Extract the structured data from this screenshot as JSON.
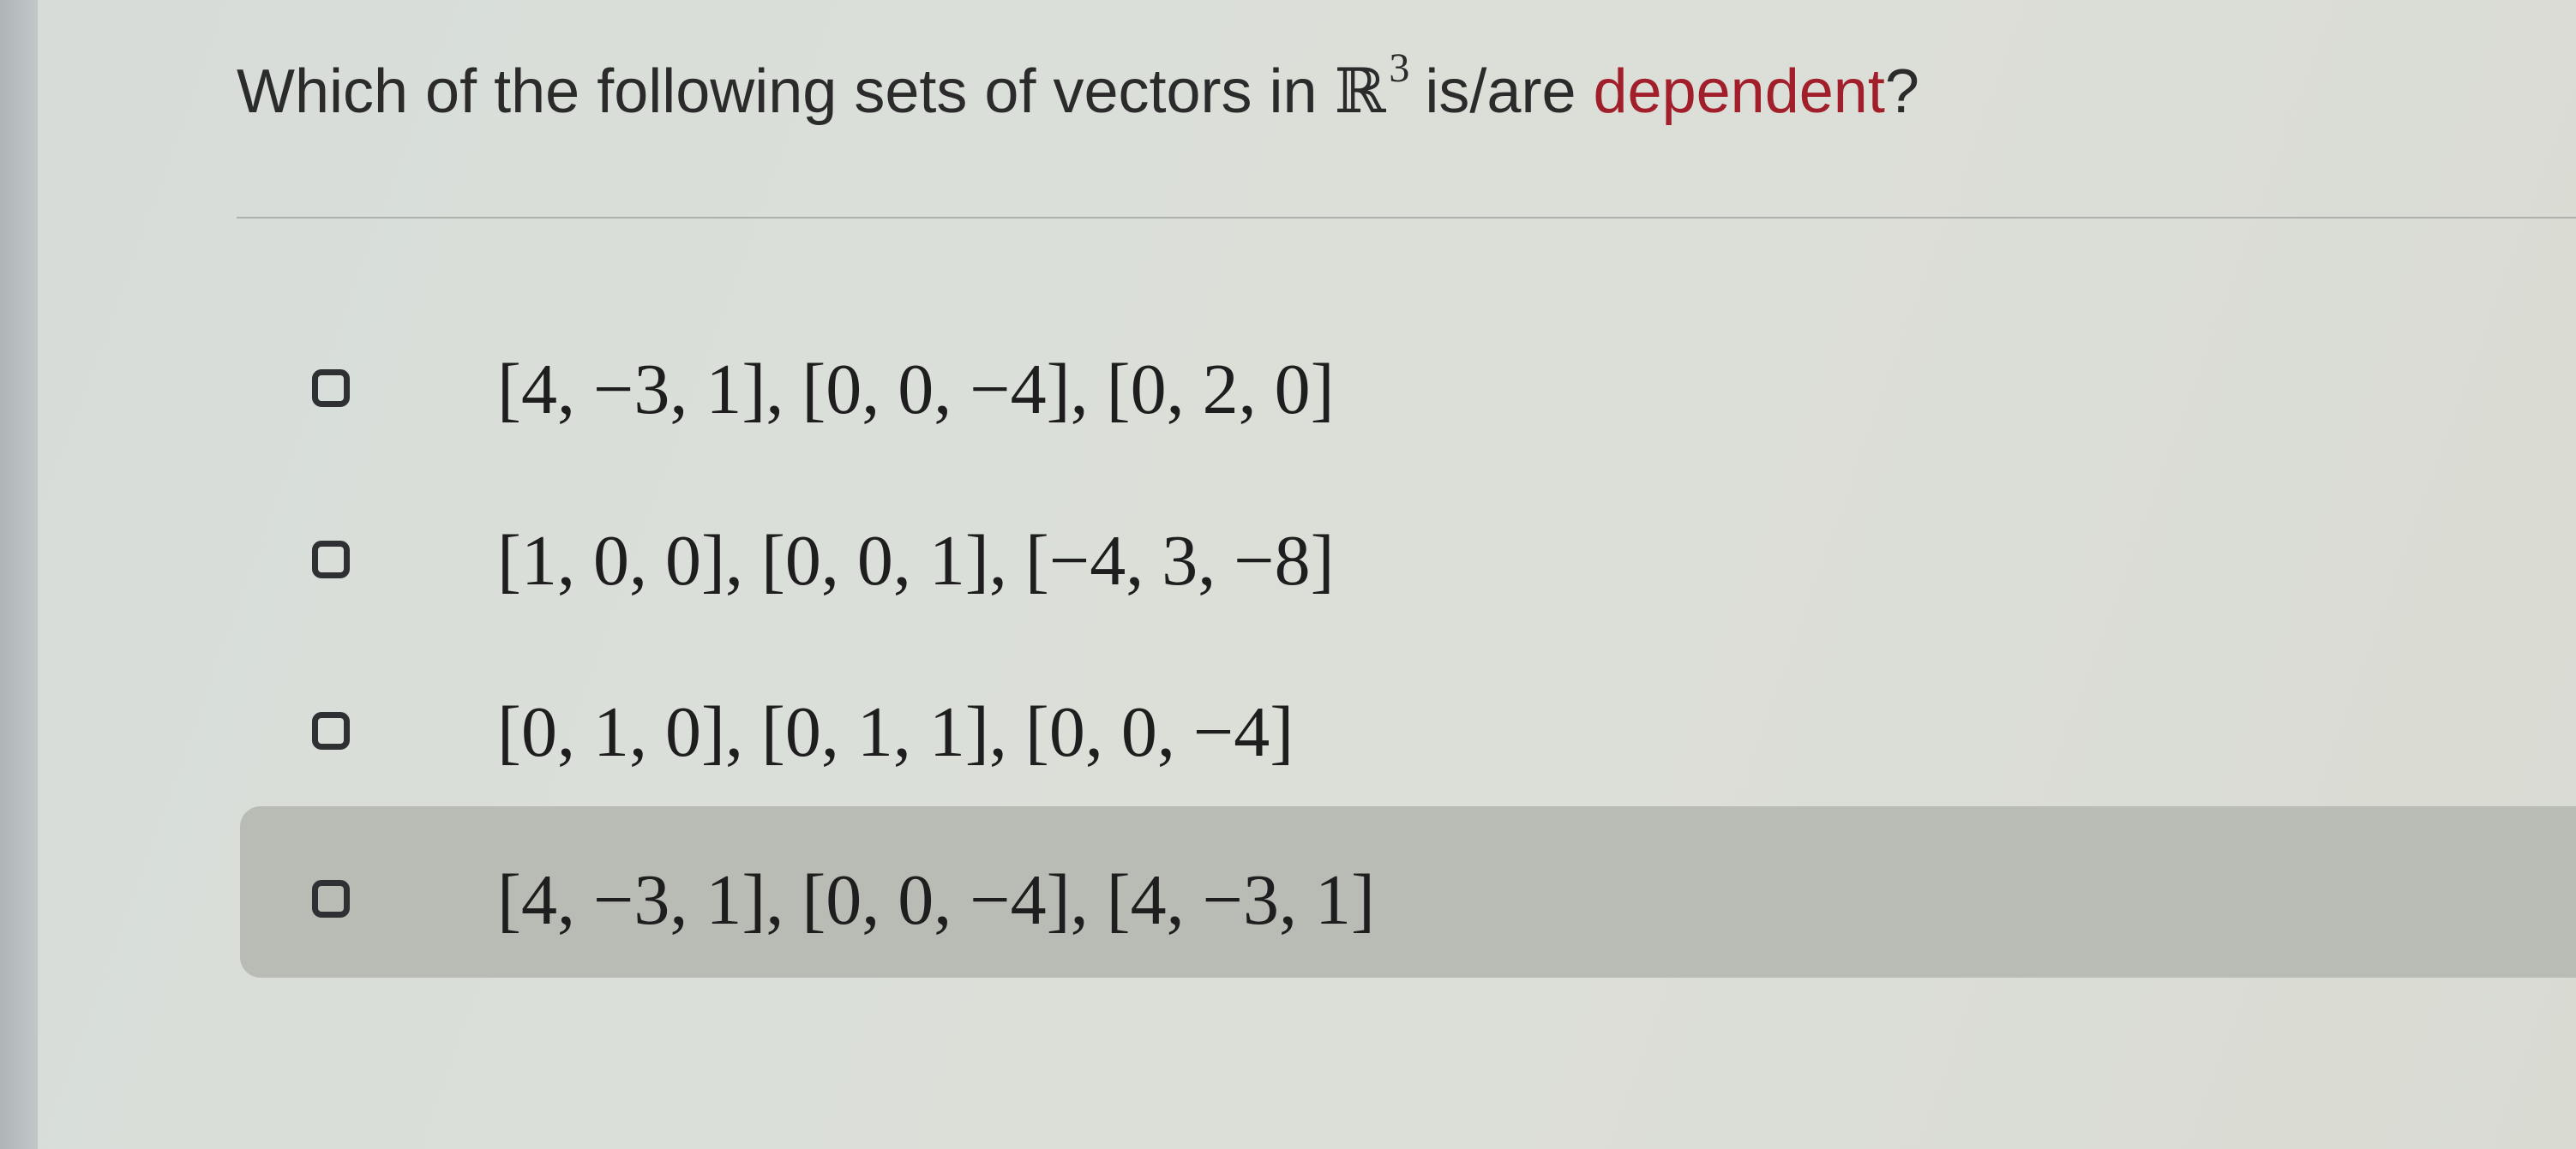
{
  "question": {
    "text_before": "Which of the following sets of vectors in",
    "space_symbol": "ℝ",
    "space_exponent": "3",
    "text_middle": "is/are",
    "highlighted_word": "dependent",
    "text_after": "?"
  },
  "options": [
    {
      "label": "[4, −3, 1], [0, 0, −4], [0, 2, 0]",
      "checked": false
    },
    {
      "label": "[1, 0, 0], [0, 0, 1], [−4, 3, −8]",
      "checked": false
    },
    {
      "label": "[0, 1, 0], [0, 1, 1], [0, 0, −4]",
      "checked": false
    },
    {
      "label": "[4, −3, 1], [0, 0, −4], [4, −3, 1]",
      "checked": false
    }
  ],
  "colors": {
    "highlight": "#a01f2a",
    "selected_row_background": "#b9bbb5"
  }
}
